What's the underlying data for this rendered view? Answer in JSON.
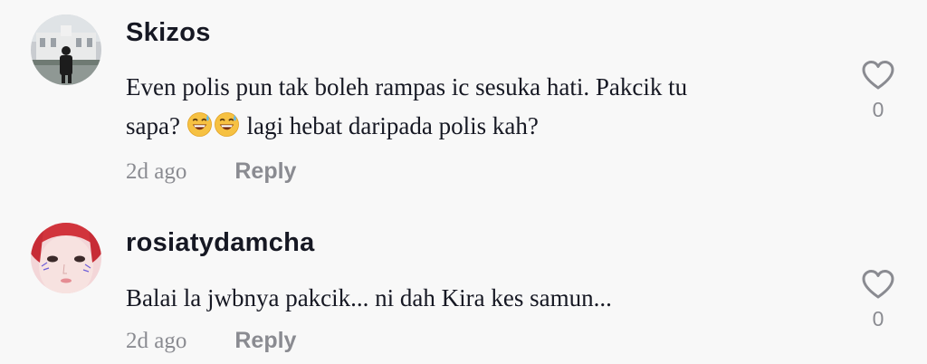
{
  "colors": {
    "background": "#f8f8f8",
    "text_primary": "#161823",
    "text_secondary": "#8a8b91"
  },
  "comments": [
    {
      "username": "Skizos",
      "text_line1": "Even polis pun tak boleh rampas ic sesuka hati. Pakcik tu",
      "text_line2_before": "sapa?",
      "emojis": [
        "grinning-sweat-emoji",
        "grinning-sweat-emoji"
      ],
      "text_line2_after": "lagi hebat daripada polis kah?",
      "time": "2d ago",
      "reply_label": "Reply",
      "like_count": "0",
      "avatar_icon": "avatar-photo-person-building"
    },
    {
      "username": "rosiatydamcha",
      "text_line1": "Balai la jwbnya pakcik... ni dah Kira kes samun...",
      "time": "2d ago",
      "reply_label": "Reply",
      "like_count": "0",
      "avatar_icon": "avatar-photo-face"
    }
  ]
}
